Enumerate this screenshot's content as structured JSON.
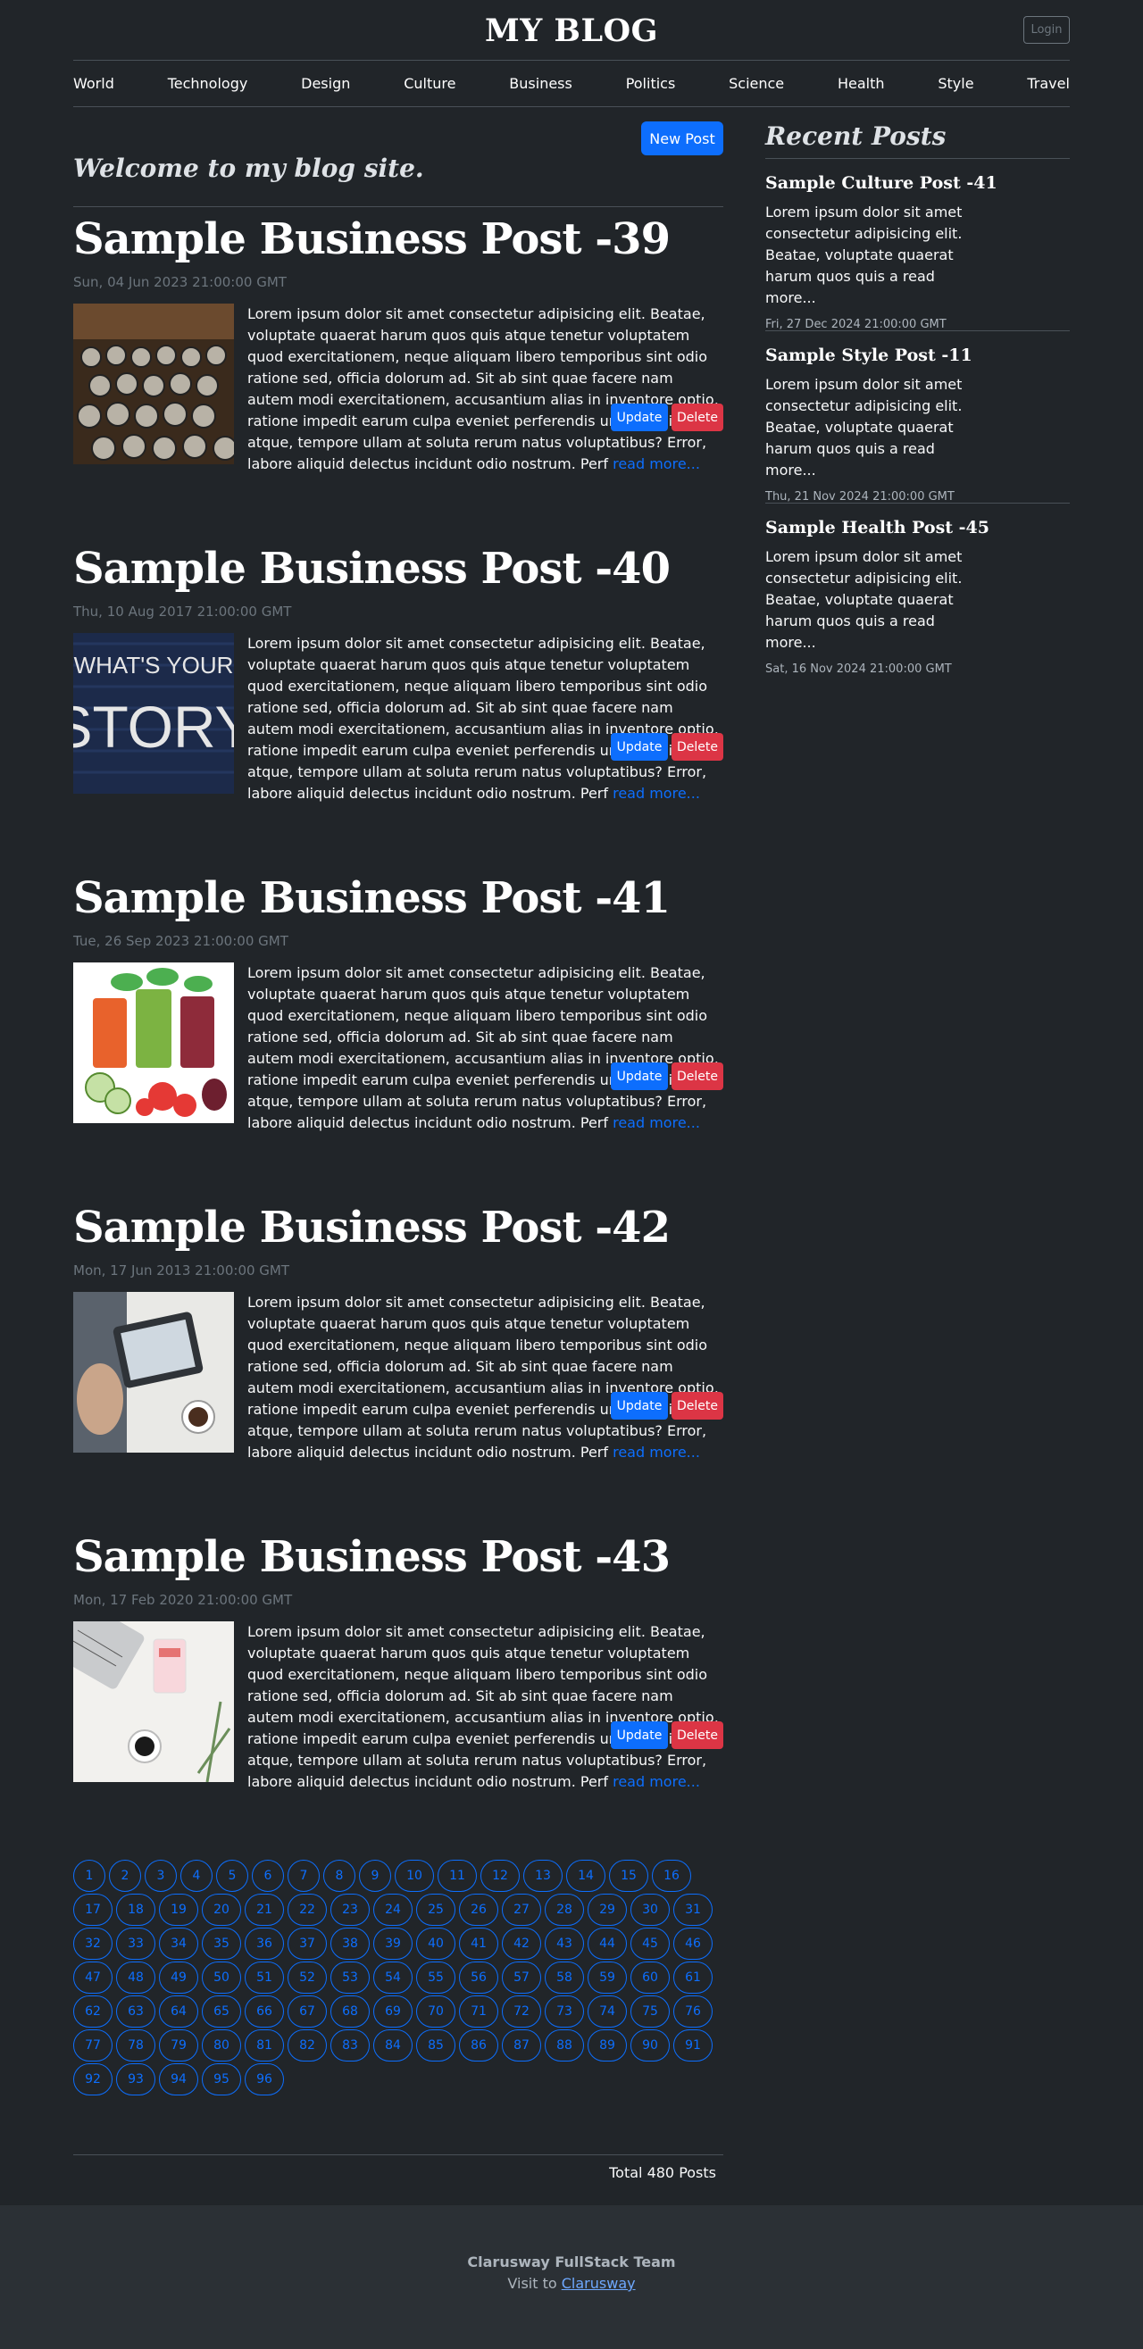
{
  "header": {
    "site_title": "MY BLOG",
    "login_label": "Login"
  },
  "nav": {
    "items": [
      "World",
      "Technology",
      "Design",
      "Culture",
      "Business",
      "Politics",
      "Science",
      "Health",
      "Style",
      "Travel"
    ]
  },
  "main": {
    "new_post_label": "New Post",
    "welcome": "Welcome to my blog site.",
    "posts": [
      {
        "title": "Sample Business Post -39",
        "date": "Sun, 04 Jun 2023 21:00:00 GMT",
        "body": "Lorem ipsum dolor sit amet consectetur adipisicing elit. Beatae, voluptate quaerat harum quos quis atque tenetur voluptatem quod exercitationem, neque aliquam libero temporibus sint odio ratione sed, officia dolorum ad. Sit ab sint quae facere nam autem modi exercitationem, accusantium alias in inventore optio, ratione impedit earum culpa eveniet perferendis unde. Nihil atque, tempore ullam at soluta rerum natus voluptatibus? Error, labore aliquid delectus incidunt odio nostrum. Perf",
        "read_more": "read more...",
        "image_icon": "typewriter-image",
        "update_label": "Update",
        "delete_label": "Delete"
      },
      {
        "title": "Sample Business Post -40",
        "date": "Thu, 10 Aug 2017 21:00:00 GMT",
        "body": "Lorem ipsum dolor sit amet consectetur adipisicing elit. Beatae, voluptate quaerat harum quos quis atque tenetur voluptatem quod exercitationem, neque aliquam libero temporibus sint odio ratione sed, officia dolorum ad. Sit ab sint quae facere nam autem modi exercitationem, accusantium alias in inventore optio, ratione impedit earum culpa eveniet perferendis unde. Nihil atque, tempore ullam at soluta rerum natus voluptatibus? Error, labore aliquid delectus incidunt odio nostrum. Perf",
        "read_more": "read more...",
        "image_icon": "story-chalkboard-image",
        "image_text_1": "WHAT'S YOUR",
        "image_text_2": "STORY",
        "update_label": "Update",
        "delete_label": "Delete"
      },
      {
        "title": "Sample Business Post -41",
        "date": "Tue, 26 Sep 2023 21:00:00 GMT",
        "body": "Lorem ipsum dolor sit amet consectetur adipisicing elit. Beatae, voluptate quaerat harum quos quis atque tenetur voluptatem quod exercitationem, neque aliquam libero temporibus sint odio ratione sed, officia dolorum ad. Sit ab sint quae facere nam autem modi exercitationem, accusantium alias in inventore optio, ratione impedit earum culpa eveniet perferendis unde. Nihil atque, tempore ullam at soluta rerum natus voluptatibus? Error, labore aliquid delectus incidunt odio nostrum. Perf",
        "read_more": "read more...",
        "image_icon": "vegetable-juice-image",
        "update_label": "Update",
        "delete_label": "Delete"
      },
      {
        "title": "Sample Business Post -42",
        "date": "Mon, 17 Jun 2013 21:00:00 GMT",
        "body": "Lorem ipsum dolor sit amet consectetur adipisicing elit. Beatae, voluptate quaerat harum quos quis atque tenetur voluptatem quod exercitationem, neque aliquam libero temporibus sint odio ratione sed, officia dolorum ad. Sit ab sint quae facere nam autem modi exercitationem, accusantium alias in inventore optio, ratione impedit earum culpa eveniet perferendis unde. Nihil atque, tempore ullam at soluta rerum natus voluptatibus? Error, labore aliquid delectus incidunt odio nostrum. Perf",
        "read_more": "read more...",
        "image_icon": "tablet-coffee-image",
        "update_label": "Update",
        "delete_label": "Delete"
      },
      {
        "title": "Sample Business Post -43",
        "date": "Mon, 17 Feb 2020 21:00:00 GMT",
        "body": "Lorem ipsum dolor sit amet consectetur adipisicing elit. Beatae, voluptate quaerat harum quos quis atque tenetur voluptatem quod exercitationem, neque aliquam libero temporibus sint odio ratione sed, officia dolorum ad. Sit ab sint quae facere nam autem modi exercitationem, accusantium alias in inventore optio, ratione impedit earum culpa eveniet perferendis unde. Nihil atque, tempore ullam at soluta rerum natus voluptatibus? Error, labore aliquid delectus incidunt odio nostrum. Perf",
        "read_more": "read more...",
        "image_icon": "laptop-desk-image",
        "update_label": "Update",
        "delete_label": "Delete"
      }
    ]
  },
  "pagination": {
    "first_page": 1,
    "last_page": 96,
    "total_text": "Total 480 Posts"
  },
  "sidebar": {
    "title": "Recent Posts",
    "items": [
      {
        "title": "Sample Culture Post -41",
        "excerpt": "Lorem ipsum dolor sit amet consectetur adipisicing elit. Beatae, voluptate quaerat harum quos quis a read more...",
        "date": "Fri, 27 Dec 2024 21:00:00 GMT"
      },
      {
        "title": "Sample Style Post -11",
        "excerpt": "Lorem ipsum dolor sit amet consectetur adipisicing elit. Beatae, voluptate quaerat harum quos quis a read more...",
        "date": "Thu, 21 Nov 2024 21:00:00 GMT"
      },
      {
        "title": "Sample Health Post -45",
        "excerpt": "Lorem ipsum dolor sit amet consectetur adipisicing elit. Beatae, voluptate quaerat harum quos quis a read more...",
        "date": "Sat, 16 Nov 2024 21:00:00 GMT"
      }
    ]
  },
  "footer": {
    "team": "Clarusway FullStack Team",
    "visit_prefix": "Visit to",
    "link_label": "Clarusway"
  },
  "colors": {
    "background": "#212529",
    "primary": "#0d6efd",
    "danger": "#dc3545",
    "muted": "#6c757d",
    "footer_bg": "#2b3035"
  }
}
